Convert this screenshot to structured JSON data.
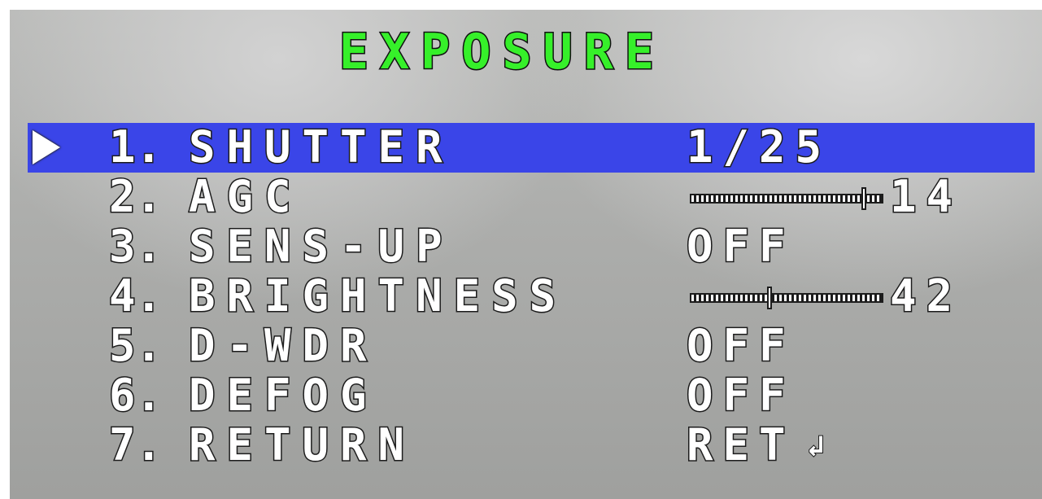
{
  "menu": {
    "title": "EXPOSURE",
    "items": [
      {
        "num": "1.",
        "label": "SHUTTER",
        "value": "1/25",
        "selected": true
      },
      {
        "num": "2.",
        "label": "AGC",
        "value": "14",
        "type": "slider",
        "level": 0.9
      },
      {
        "num": "3.",
        "label": "SENS-UP",
        "value": "OFF"
      },
      {
        "num": "4.",
        "label": "BRIGHTNESS",
        "value": "42",
        "type": "slider",
        "level": 0.4
      },
      {
        "num": "5.",
        "label": "D-WDR",
        "value": "OFF"
      },
      {
        "num": "6.",
        "label": "DEFOG",
        "value": "OFF"
      },
      {
        "num": "7.",
        "label": "RETURN",
        "value": "RET",
        "icon": "return-arrow-icon"
      }
    ]
  },
  "colors": {
    "title": "#36f02a",
    "highlight": "#3a45e8",
    "text": "#ffffff"
  }
}
